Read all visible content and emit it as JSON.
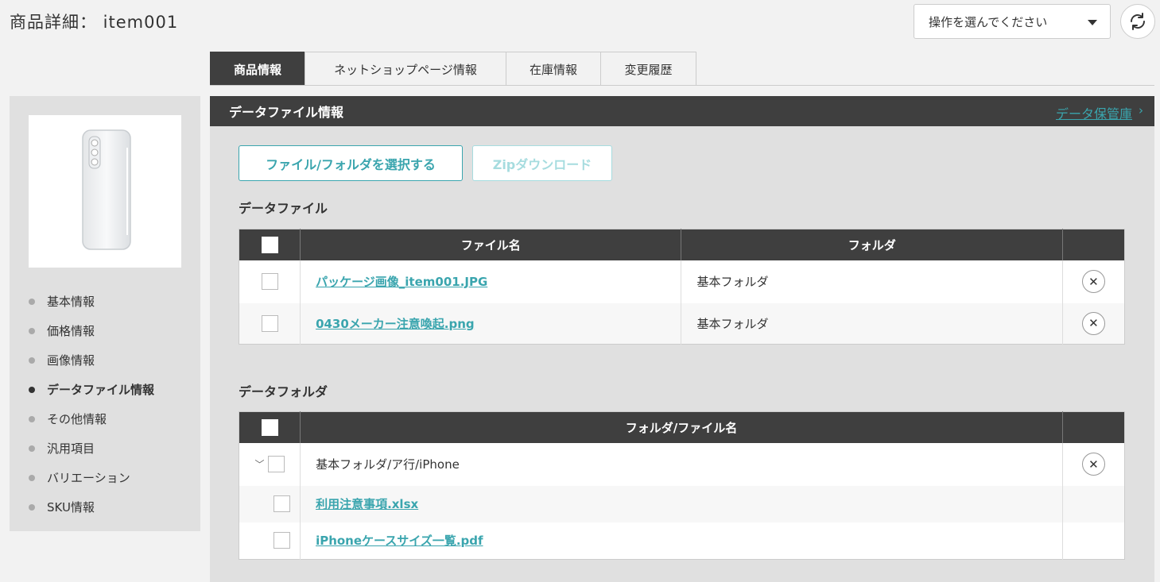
{
  "header": {
    "title": "商品詳細： item001",
    "action_select": "操作を選んでください"
  },
  "tabs": [
    {
      "label": "商品情報",
      "active": true
    },
    {
      "label": "ネットショップページ情報",
      "active": false
    },
    {
      "label": "在庫情報",
      "active": false
    },
    {
      "label": "変更履歴",
      "active": false
    }
  ],
  "sidebar": {
    "items": [
      {
        "label": "基本情報"
      },
      {
        "label": "価格情報"
      },
      {
        "label": "画像情報"
      },
      {
        "label": "データファイル情報",
        "active": true
      },
      {
        "label": "その他情報"
      },
      {
        "label": "汎用項目"
      },
      {
        "label": "バリエーション"
      },
      {
        "label": "SKU情報"
      }
    ]
  },
  "section": {
    "title": "データファイル情報",
    "storage_link": "データ保管庫",
    "select_button": "ファイル/フォルダを選択する",
    "zip_button": "Zipダウンロード"
  },
  "files": {
    "heading": "データファイル",
    "col_name": "ファイル名",
    "col_folder": "フォルダ",
    "rows": [
      {
        "name": "パッケージ画像_item001.JPG",
        "folder": "基本フォルダ"
      },
      {
        "name": "0430メーカー注意喚起.png",
        "folder": "基本フォルダ"
      }
    ]
  },
  "folders": {
    "heading": "データフォルダ",
    "col_name": "フォルダ/ファイル名",
    "folder_path": "基本フォルダ/ア行/iPhone",
    "children": [
      {
        "name": "利用注意事項.xlsx"
      },
      {
        "name": "iPhoneケースサイズ一覧.pdf"
      }
    ]
  },
  "colors": {
    "accent": "#3aa5ae",
    "dark_header": "#3f3f3f",
    "panel_bg": "#e0e0e0"
  }
}
